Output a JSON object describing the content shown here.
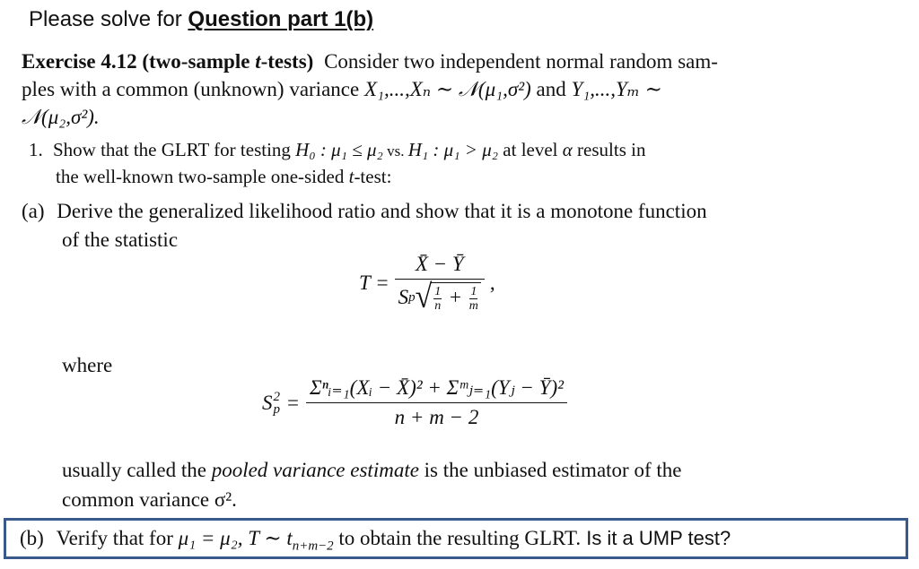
{
  "prompt": {
    "prefix": "Please solve for ",
    "emphasis": "Question part 1(b)"
  },
  "exercise": {
    "title": "Exercise 4.12 (two-sample ",
    "title_t": "t",
    "title_end": "-tests)",
    "intro_line1": "Consider two independent normal random sam-",
    "intro_line2_a": "ples with a common (unknown) variance ",
    "intro_line2_math1": "X₁,...,Xₙ ∼ 𝒩(μ₁,σ²)",
    "intro_line2_and": " and ",
    "intro_line2_math2": "Y₁,...,Yₘ ∼",
    "intro_line3_math": "𝒩(μ₂,σ²)."
  },
  "part1": {
    "number": "1.",
    "text_a": "Show that the GLRT for testing ",
    "h0": "H₀ : μ₁ ≤ μ₂",
    "vs": " vs. ",
    "h1": "H₁ : μ₁ > μ₂",
    "text_b": " at level ",
    "alpha": "α",
    "text_c": " results in",
    "line2_a": "the well-known two-sample one-sided ",
    "line2_t": "t",
    "line2_b": "-test:"
  },
  "part_a": {
    "label": "(a)",
    "line1": "Derive the generalized likelihood ratio and show that it is a monotone function",
    "line2": "of the statistic",
    "formula_T": {
      "lhs": "T =",
      "numerator": "X̄ − Ȳ",
      "denominator_sp": "S",
      "denominator_sub": "p",
      "frac1_num": "1",
      "frac1_den": "n",
      "plus": "+",
      "frac2_num": "1",
      "frac2_den": "m",
      "trailing": ","
    },
    "where": "where",
    "formula_Sp": {
      "lhs": "S",
      "lhs_sub": "p",
      "lhs_sup": "2",
      "eq": "=",
      "numerator": "Σⁿᵢ₌₁(Xᵢ − X̄)² + Σᵐⱼ₌₁(Yⱼ − Ȳ)²",
      "denominator": "n + m − 2"
    },
    "tail_line1_a": "usually called the ",
    "tail_line1_italic": "pooled variance estimate",
    "tail_line1_b": " is the unbiased estimator of the",
    "tail_line2": "common variance σ²."
  },
  "part_b": {
    "label": "(b)",
    "text_a": "Verify that for ",
    "math": "μ₁ = μ₂, T ∼ t",
    "math_sub": "n+m−2",
    "text_b": " to obtain the resulting GLRT.",
    "question": " Is it a UMP test?"
  },
  "colors": {
    "box_border": "#3a5a8c",
    "text": "#111111"
  }
}
